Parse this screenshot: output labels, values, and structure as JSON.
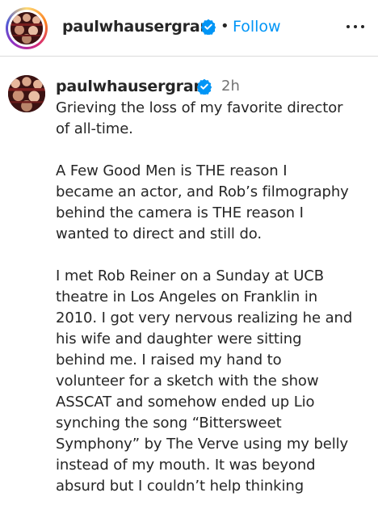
{
  "header": {
    "username": "paulwhausergram",
    "separator": "•",
    "follow_label": "Follow",
    "more_icon": "more-horizontal-icon"
  },
  "comment": {
    "username": "paulwhausergram",
    "time": "2h",
    "paragraphs": [
      [
        "Grieving the loss of my favorite director",
        "of all-time."
      ],
      [
        "A Few Good Men is THE reason I",
        "became an actor, and Rob’s filmography",
        "behind the camera is THE reason I",
        "wanted to direct and still do."
      ],
      [
        "I met Rob Reiner on a Sunday at UCB",
        "theatre in Los Angeles on Franklin in",
        "2010. I got very nervous realizing he and",
        "his wife and daughter were sitting",
        "behind me. I raised my hand to",
        "volunteer for a sketch with the show",
        "ASSCAT and somehow ended up Lio",
        "synching the song “Bittersweet",
        "Symphony” by The Verve using my belly",
        "instead of my mouth. It was beyond",
        "absurd but I couldn’t help thinking"
      ]
    ]
  },
  "colors": {
    "accent": "#0095f6",
    "verified": "#0095f6",
    "text": "#262626",
    "muted": "#737373"
  }
}
